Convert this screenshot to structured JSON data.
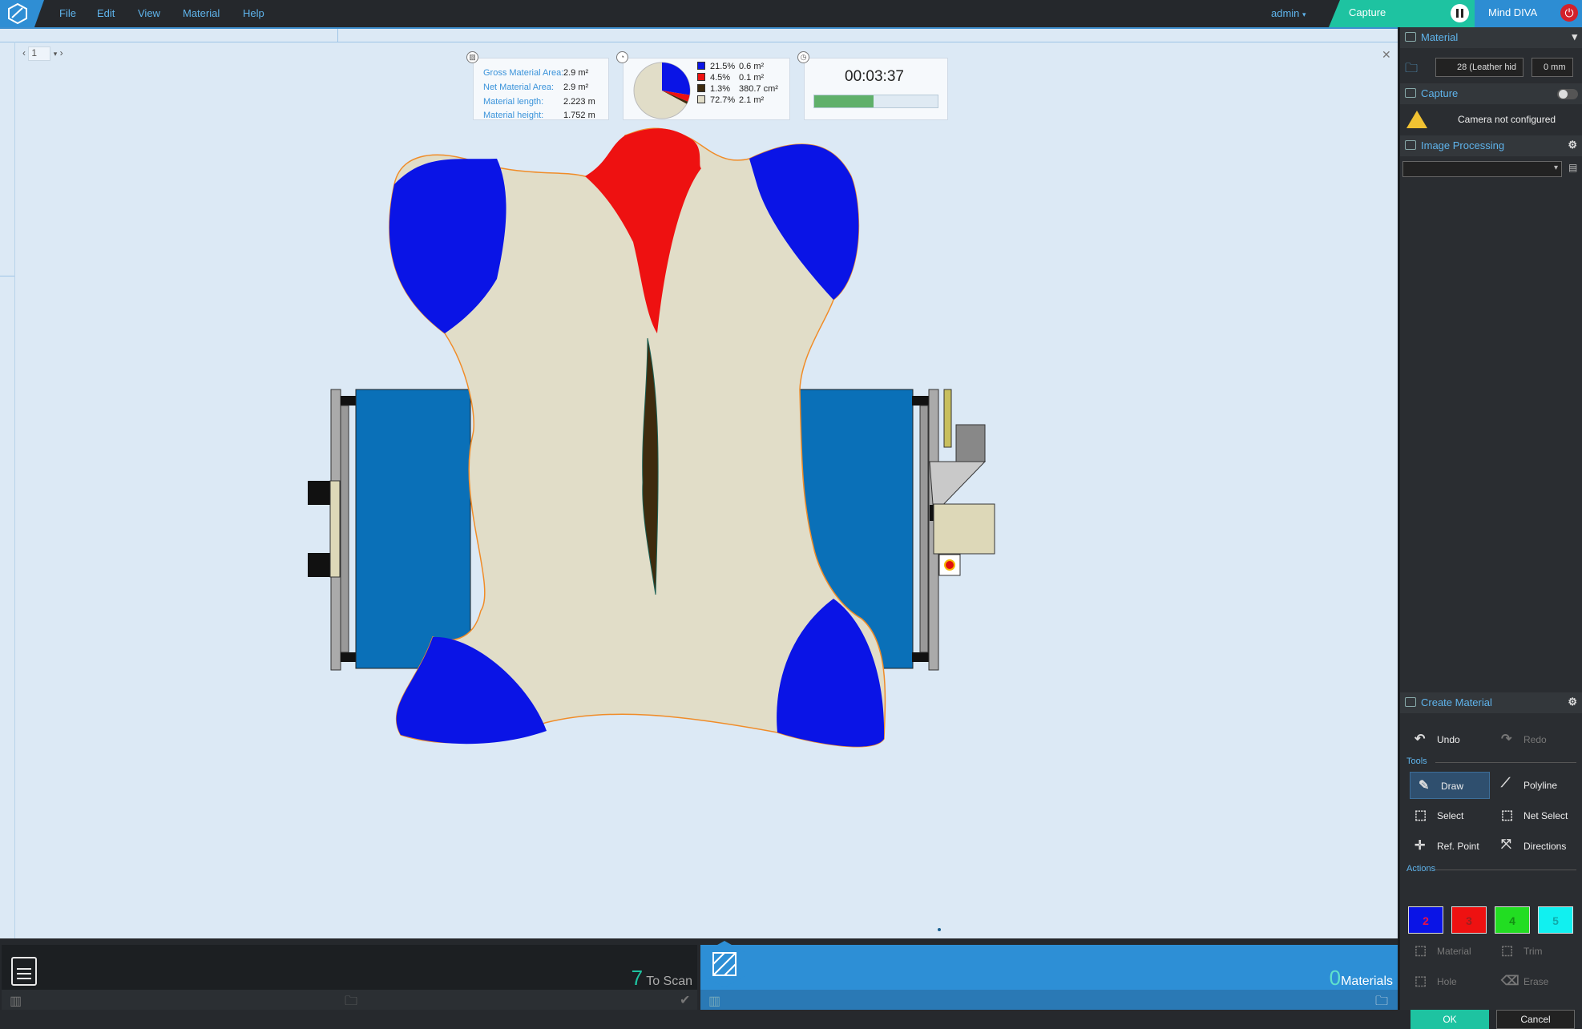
{
  "menu": [
    "File",
    "Edit",
    "View",
    "Material",
    "Help"
  ],
  "user": "admin",
  "capture_tab": "Capture",
  "app_tab": "Mind DIVA",
  "pager_value": "1",
  "stats": {
    "rows": [
      {
        "label": "Gross Material Area:",
        "value": "2.9 m²"
      },
      {
        "label": "Net Material Area:",
        "value": "2.9 m²"
      },
      {
        "label": "Material length:",
        "value": "2.223 m"
      },
      {
        "label": "Material height:",
        "value": "1.752 m"
      }
    ]
  },
  "legend": [
    {
      "pct": "21.5%",
      "val": "0.6 m²",
      "color": "#0a14e6"
    },
    {
      "pct": "4.5%",
      "val": "0.1 m²",
      "color": "#ee1111"
    },
    {
      "pct": "1.3%",
      "val": "380.7 cm²",
      "color": "#3e2b0e"
    },
    {
      "pct": "72.7%",
      "val": "2.1 m²",
      "color": "#e1ddc8"
    }
  ],
  "timer": "00:03:37",
  "progress": 0.48,
  "bottom": {
    "to_scan_count": "7",
    "to_scan_label": "To Scan",
    "materials_count": "0",
    "materials_label": "Materials"
  },
  "panel": {
    "material_title": "Material",
    "material_select": "28 (Leather hid",
    "offset": "0 mm",
    "capture_title": "Capture",
    "camera_status": "Camera not configured",
    "image_processing_title": "Image Processing",
    "create_material_title": "Create Material",
    "undo": "Undo",
    "redo": "Redo",
    "tools_label": "Tools",
    "draw": "Draw",
    "polyline": "Polyline",
    "select": "Select",
    "net_select": "Net Select",
    "ref_point": "Ref. Point",
    "directions": "Directions",
    "actions_label": "Actions",
    "color_buttons": [
      {
        "n": "2",
        "bg": "#0a14e6",
        "fg": "#e14"
      },
      {
        "n": "3",
        "bg": "#ee1111",
        "fg": "#9a2020"
      },
      {
        "n": "4",
        "bg": "#22dd22",
        "fg": "#138e13"
      },
      {
        "n": "5",
        "bg": "#11f0f0",
        "fg": "#1aa"
      }
    ],
    "material_action": "Material",
    "trim": "Trim",
    "hole": "Hole",
    "erase": "Erase",
    "ok": "OK",
    "cancel": "Cancel"
  }
}
